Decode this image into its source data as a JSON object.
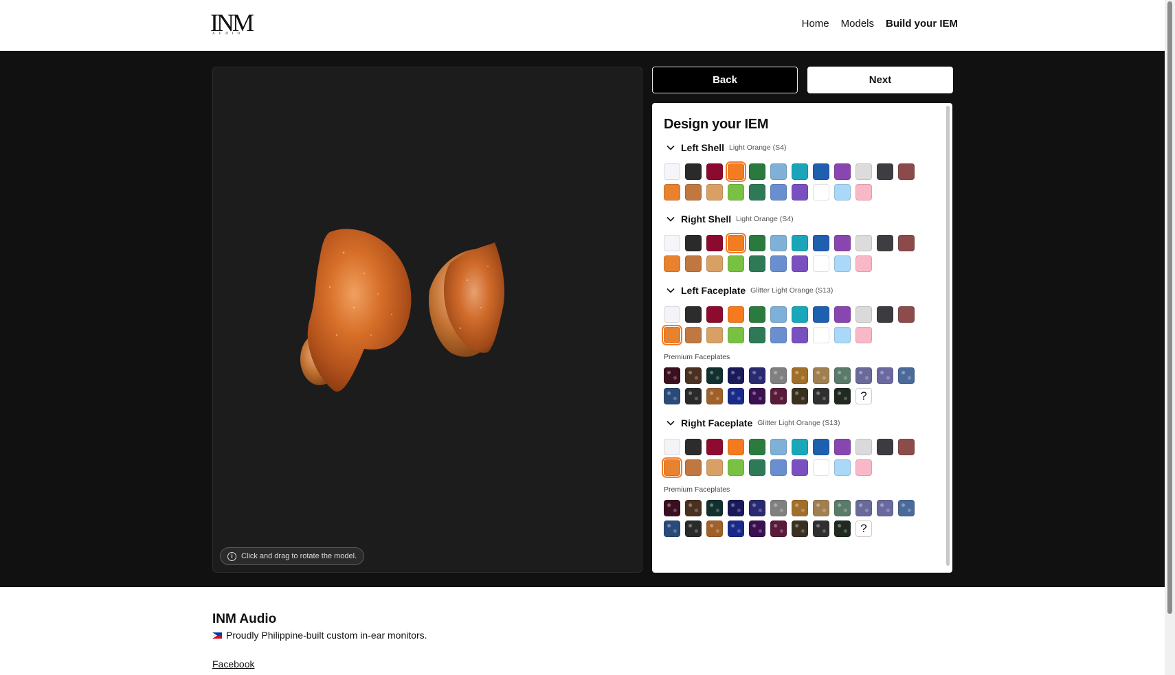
{
  "header": {
    "logo_text": "INM",
    "logo_sub": "AUDIO",
    "nav": [
      {
        "label": "Home"
      },
      {
        "label": "Models"
      },
      {
        "label": "Build your IEM"
      }
    ]
  },
  "viewer": {
    "hint": "Click and drag to rotate the model.",
    "icon": "info-icon"
  },
  "actions": {
    "back_label": "Back",
    "next_label": "Next"
  },
  "panel": {
    "title": "Design your IEM",
    "premium_label": "Premium Faceplates",
    "sections": [
      {
        "name": "Left Shell",
        "selected": "Light Orange (S4)"
      },
      {
        "name": "Right Shell",
        "selected": "Light Orange (S4)"
      },
      {
        "name": "Left Faceplate",
        "selected": "Glitter Light Orange (S13)"
      },
      {
        "name": "Right Faceplate",
        "selected": "Glitter Light Orange (S13)"
      }
    ],
    "solid_colors": [
      "#f6f6fa",
      "#2a2a2a",
      "#8c0a2e",
      "#f47c20",
      "#2a7a3e",
      "#7fb0d8",
      "#1aa6b8",
      "#1f5fb0",
      "#8a46b0",
      "#dcdcdc",
      "#3e3e42",
      "#8c4a4a",
      "#e8822e",
      "#c07840",
      "#d9a066",
      "#79c142",
      "#2f7a56",
      "#6a8fd0",
      "#7a50c0",
      "#ffffff",
      "#a9d8f8",
      "#f9b8c8"
    ],
    "glitter_colors": [
      "#f4f4f8",
      "#2c2c2c",
      "#8e0b30",
      "#f57a1e",
      "#2b7b3f",
      "#7eb0d8",
      "#18a8ba",
      "#1e60b0",
      "#8846b0",
      "#dadada",
      "#3c3c40",
      "#8c4c4c",
      "#e8822e",
      "#c07840",
      "#d9a066",
      "#79c142",
      "#2f7a56",
      "#6a8fd0",
      "#7a50c0",
      "#ffffff",
      "#a9d8f8",
      "#f9b8c8"
    ],
    "premium_colors": [
      "#3a1020",
      "#4a3020",
      "#12302e",
      "#1a1a5a",
      "#2a2a70",
      "#808080",
      "#a0702a",
      "#a08050",
      "#5a7a6a",
      "#6a6a9a",
      "#6a6aa0",
      "#4a6a9a",
      "#2a4a7a",
      "#2a2a2a",
      "#a0602a",
      "#1a2a8a",
      "#3a1050",
      "#5a1a3a",
      "#3a3020",
      "#303030",
      "#202a20",
      "?"
    ],
    "selected_index": {
      "left_shell": 3,
      "right_shell": 3,
      "left_faceplate": 12,
      "right_faceplate": 12
    }
  },
  "footer": {
    "title": "INM Audio",
    "tagline": "Proudly Philippine-built custom in-ear monitors.",
    "link": "Facebook"
  }
}
